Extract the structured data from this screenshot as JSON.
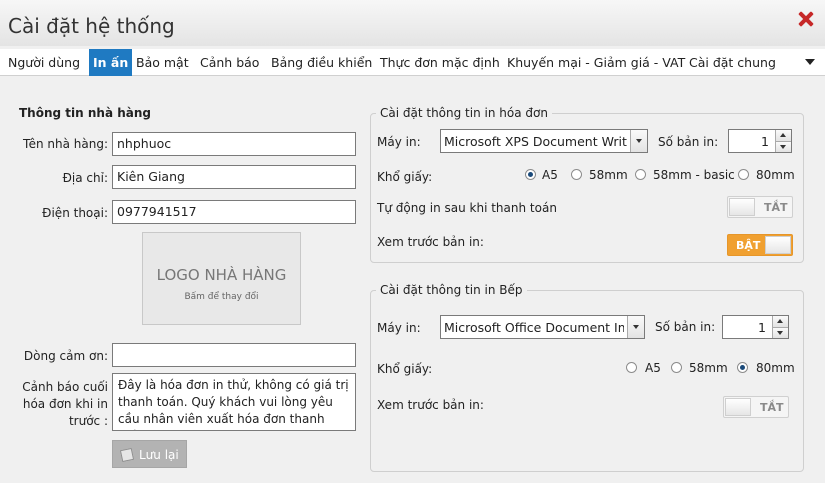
{
  "window": {
    "title": "Cài đặt hệ thống"
  },
  "tabs": [
    {
      "label": "Người dùng"
    },
    {
      "label": "In ấn"
    },
    {
      "label": "Bảo mật"
    },
    {
      "label": "Cảnh báo"
    },
    {
      "label": "Bảng điều khiển"
    },
    {
      "label": "Thực đơn mặc định"
    },
    {
      "label": "Khuyến mại - Giảm giá - VAT"
    },
    {
      "label": "Cài đặt chung"
    }
  ],
  "restaurant": {
    "section_title": "Thông tin nhà hàng",
    "name_label": "Tên nhà hàng:",
    "name_value": "nhphuoc",
    "address_label": "Địa chỉ:",
    "address_value": "Kiên Giang",
    "phone_label": "Điện thoại:",
    "phone_value": "0977941517",
    "logo_title": "LOGO NHÀ HÀNG",
    "logo_hint": "Bấm để thay đổi",
    "thanks_label": "Dòng cảm ơn:",
    "thanks_value": "",
    "warning_label_1": "Cảnh báo cuối",
    "warning_label_2": "hóa đơn khi in",
    "warning_label_3": "trước :",
    "warning_value": "Đây là hóa đơn in thử, không có giá trị thanh toán. Quý khách vui lòng yêu cầu nhân viên xuất hóa đơn thanh toán.",
    "save_label": "Lưu lại"
  },
  "invoice_print": {
    "legend": "Cài đặt thông tin in hóa đơn",
    "printer_label": "Máy in:",
    "printer_value": "Microsoft XPS Document Writer",
    "copies_label": "Số bản in:",
    "copies_value": "1",
    "paper_label": "Khổ giấy:",
    "paper_options": [
      "A5",
      "58mm",
      "58mm - basic",
      "80mm"
    ],
    "paper_selected": "A5",
    "auto_print_label": "Tự động in sau khi thanh toán",
    "auto_print_state": "TẮT",
    "preview_label": "Xem trước bản in:",
    "preview_state": "BẬT"
  },
  "kitchen_print": {
    "legend": "Cài đặt thông tin in Bếp",
    "printer_label": "Máy in:",
    "printer_value": "Microsoft Office Document Ima",
    "copies_label": "Số bản in:",
    "copies_value": "1",
    "paper_label": "Khổ giấy:",
    "paper_options": [
      "A5",
      "58mm",
      "80mm"
    ],
    "paper_selected": "80mm",
    "preview_label": "Xem trước bản in:",
    "preview_state": "TẮT"
  },
  "colors": {
    "accent": "#1f7ac2",
    "toggle_on": "#f0a030",
    "close": "#c62828"
  },
  "icons": {
    "close": "close-icon",
    "more": "chevron-down-icon",
    "save": "save-icon"
  }
}
